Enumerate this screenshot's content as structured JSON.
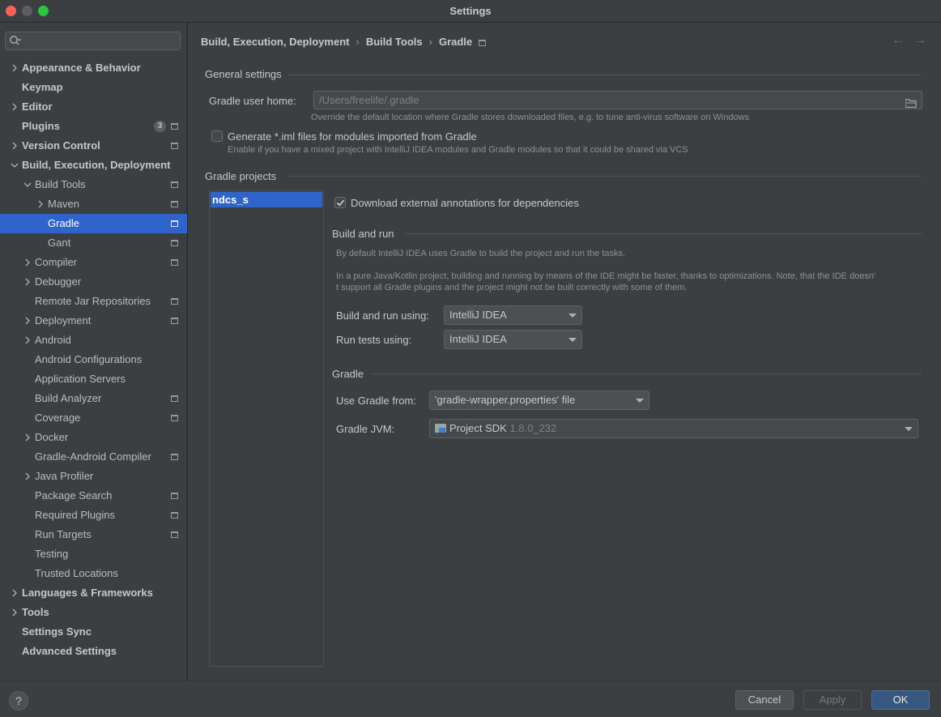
{
  "window": {
    "title": "Settings"
  },
  "search": {
    "placeholder": ""
  },
  "sidebar": {
    "items": [
      {
        "label": "Appearance & Behavior",
        "bold": true,
        "chevron": true,
        "indent": 0
      },
      {
        "label": "Keymap",
        "bold": true,
        "chevron": false,
        "indent": 0
      },
      {
        "label": "Editor",
        "bold": true,
        "chevron": true,
        "indent": 0
      },
      {
        "label": "Plugins",
        "bold": true,
        "chevron": false,
        "indent": 0,
        "badge": "3",
        "project_icon": true
      },
      {
        "label": "Version Control",
        "bold": true,
        "chevron": true,
        "indent": 0,
        "project_icon": true
      },
      {
        "label": "Build, Execution, Deployment",
        "bold": true,
        "chevron": true,
        "expanded": true,
        "indent": 0
      },
      {
        "label": "Build Tools",
        "bold": false,
        "chevron": true,
        "expanded": true,
        "indent": 1,
        "project_icon": true
      },
      {
        "label": "Maven",
        "bold": false,
        "chevron": true,
        "indent": 2,
        "project_icon": true
      },
      {
        "label": "Gradle",
        "bold": false,
        "chevron": false,
        "indent": 2,
        "project_icon": true,
        "selected": true
      },
      {
        "label": "Gant",
        "bold": false,
        "chevron": false,
        "indent": 2,
        "project_icon": true
      },
      {
        "label": "Compiler",
        "bold": false,
        "chevron": true,
        "indent": 1,
        "project_icon": true
      },
      {
        "label": "Debugger",
        "bold": false,
        "chevron": true,
        "indent": 1
      },
      {
        "label": "Remote Jar Repositories",
        "bold": false,
        "chevron": false,
        "indent": 1,
        "project_icon": true
      },
      {
        "label": "Deployment",
        "bold": false,
        "chevron": true,
        "indent": 1,
        "project_icon": true
      },
      {
        "label": "Android",
        "bold": false,
        "chevron": true,
        "indent": 1
      },
      {
        "label": "Android Configurations",
        "bold": false,
        "chevron": false,
        "indent": 1
      },
      {
        "label": "Application Servers",
        "bold": false,
        "chevron": false,
        "indent": 1
      },
      {
        "label": "Build Analyzer",
        "bold": false,
        "chevron": false,
        "indent": 1,
        "project_icon": true
      },
      {
        "label": "Coverage",
        "bold": false,
        "chevron": false,
        "indent": 1,
        "project_icon": true
      },
      {
        "label": "Docker",
        "bold": false,
        "chevron": true,
        "indent": 1
      },
      {
        "label": "Gradle-Android Compiler",
        "bold": false,
        "chevron": false,
        "indent": 1,
        "project_icon": true
      },
      {
        "label": "Java Profiler",
        "bold": false,
        "chevron": true,
        "indent": 1
      },
      {
        "label": "Package Search",
        "bold": false,
        "chevron": false,
        "indent": 1,
        "project_icon": true
      },
      {
        "label": "Required Plugins",
        "bold": false,
        "chevron": false,
        "indent": 1,
        "project_icon": true
      },
      {
        "label": "Run Targets",
        "bold": false,
        "chevron": false,
        "indent": 1,
        "project_icon": true
      },
      {
        "label": "Testing",
        "bold": false,
        "chevron": false,
        "indent": 1
      },
      {
        "label": "Trusted Locations",
        "bold": false,
        "chevron": false,
        "indent": 1
      },
      {
        "label": "Languages & Frameworks",
        "bold": true,
        "chevron": true,
        "indent": 0
      },
      {
        "label": "Tools",
        "bold": true,
        "chevron": true,
        "indent": 0
      },
      {
        "label": "Settings Sync",
        "bold": true,
        "chevron": false,
        "indent": 0
      },
      {
        "label": "Advanced Settings",
        "bold": true,
        "chevron": false,
        "indent": 0
      }
    ]
  },
  "breadcrumb": {
    "parts": [
      "Build, Execution, Deployment",
      "Build Tools",
      "Gradle"
    ],
    "separator": "›"
  },
  "general": {
    "title": "General settings",
    "user_home_label": "Gradle user home:",
    "user_home_placeholder": "/Users/freelife/.gradle",
    "user_home_hint": "Override the default location where Gradle stores downloaded files, e.g. to tune anti-virus software on Windows",
    "iml_label": "Generate *.iml files for modules imported from Gradle",
    "iml_checked": false,
    "iml_hint": "Enable if you have a mixed project with IntelliJ IDEA modules and Gradle modules so that it could be shared via VCS"
  },
  "projects": {
    "title": "Gradle projects",
    "items": [
      "ndcs_s"
    ],
    "download_annotations_label": "Download external annotations for dependencies",
    "download_annotations_checked": true
  },
  "build_run": {
    "title": "Build and run",
    "hint1": "By default IntelliJ IDEA uses Gradle to build the project and run the tasks.",
    "hint2a": "In a pure Java/Kotlin project, building and running by means of the IDE might be faster, thanks to optimizations. Note, that the IDE doesn'",
    "hint2b": "t support all Gradle plugins and the project might not be built correctly with some of them.",
    "using_label": "Build and run using:",
    "using_value": "IntelliJ IDEA",
    "tests_label": "Run tests using:",
    "tests_value": "IntelliJ IDEA"
  },
  "gradle": {
    "title": "Gradle",
    "from_label": "Use Gradle from:",
    "from_value": "'gradle-wrapper.properties' file",
    "jvm_label": "Gradle JVM:",
    "jvm_value": "Project SDK",
    "jvm_version": "1.8.0_232"
  },
  "footer": {
    "cancel": "Cancel",
    "apply": "Apply",
    "ok": "OK",
    "help": "?"
  },
  "nav": {
    "back": "←",
    "forward": "→"
  }
}
